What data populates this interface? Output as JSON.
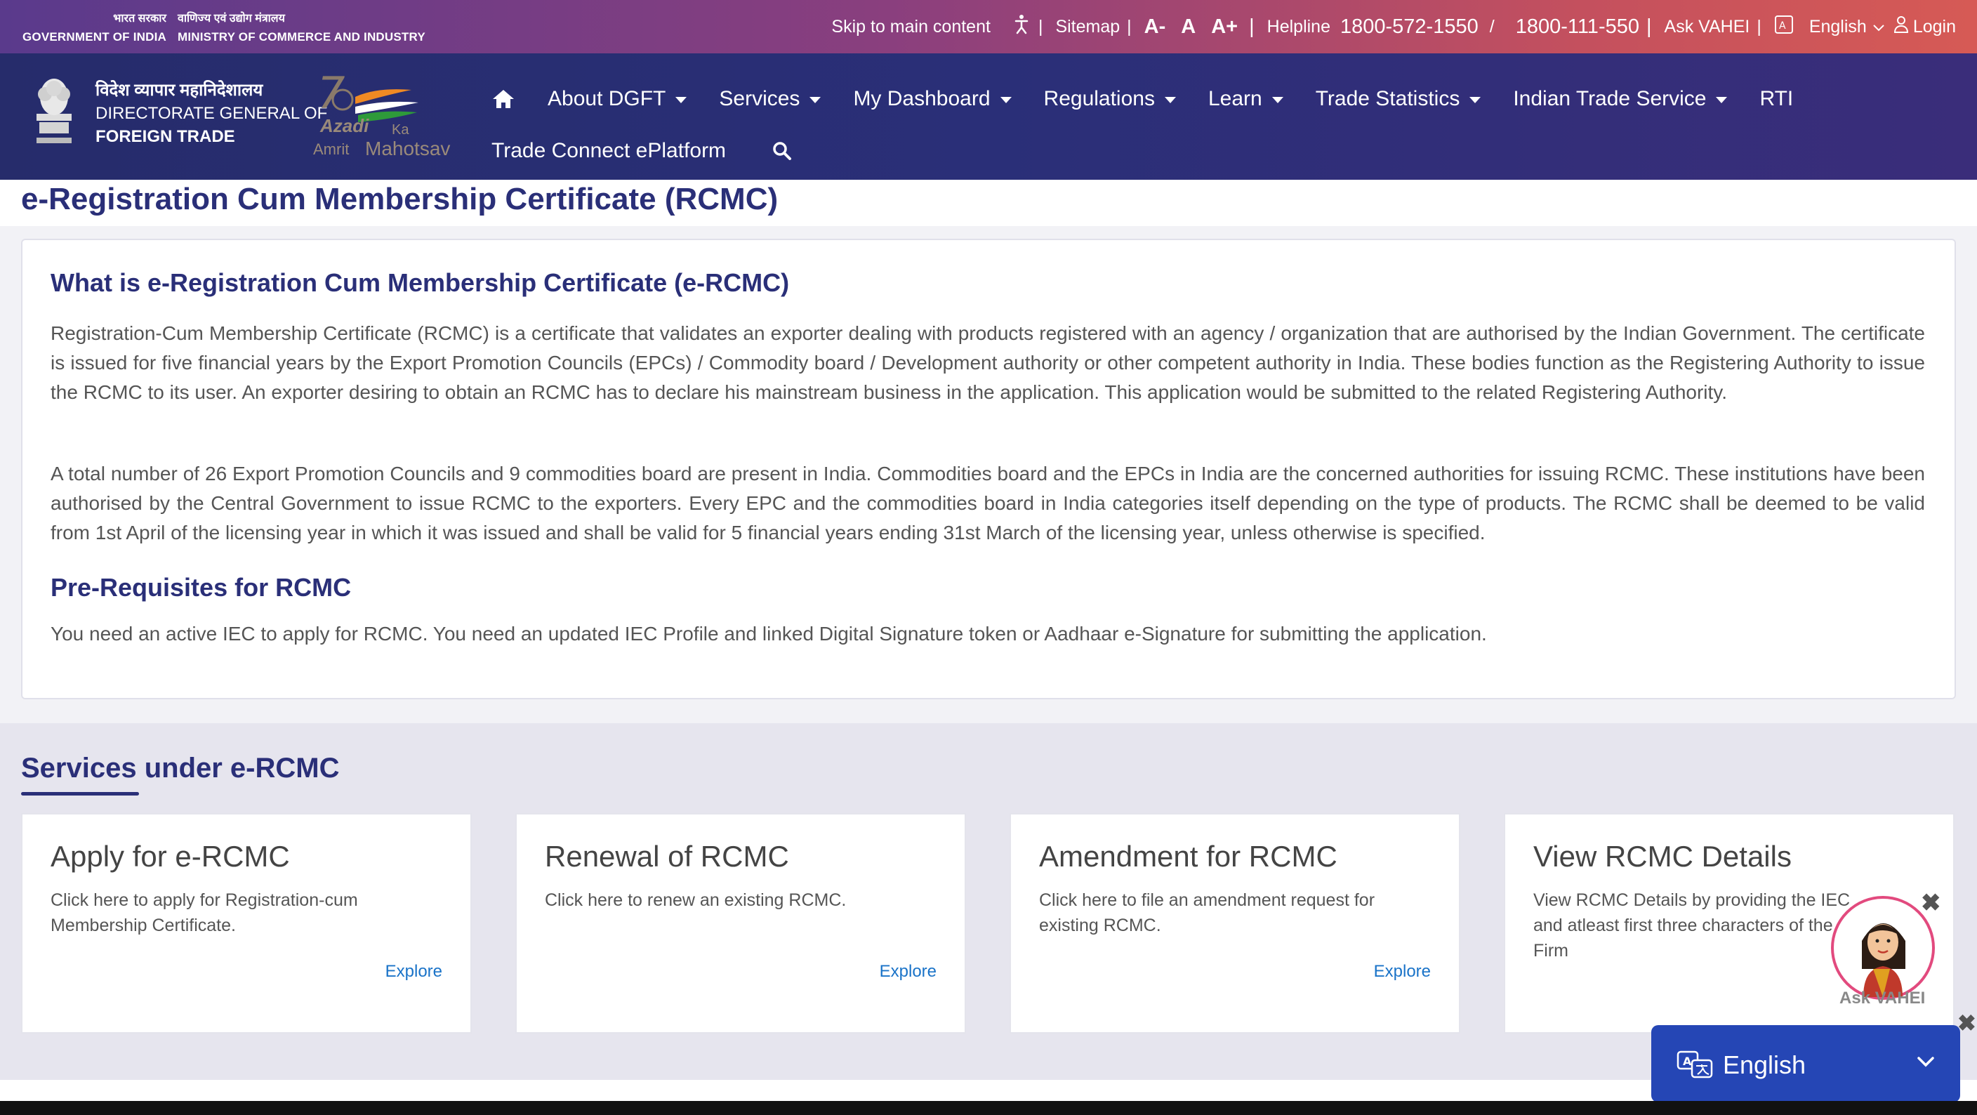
{
  "gov_header": {
    "hindi_gov": "भारत सरकार",
    "hindi_ministry": "वाणिज्य एवं उद्योग मंत्रालय",
    "english_gov": "GOVERNMENT OF INDIA",
    "english_ministry": "MINISTRY OF COMMERCE AND INDUSTRY"
  },
  "utility_bar": {
    "skip": "Skip to main content",
    "sitemap": "Sitemap",
    "font_small": "A-",
    "font_normal": "A",
    "font_large": "A+",
    "helpline_label": "Helpline",
    "helpline_1": "1800-572-1550",
    "helpline_2": "1800-111-550",
    "ask": "Ask VAHEI",
    "language": "English",
    "login": "Login"
  },
  "brand": {
    "hindi": "विदेश व्यापार महानिदेशालय",
    "line1": "DIRECTORATE GENERAL OF",
    "line2": "FOREIGN TRADE",
    "aka_azadi": "Azadi",
    "aka_ka": "Ka",
    "aka_amrit": "Amrit",
    "aka_mahotsav": "Mahotsav"
  },
  "nav": {
    "items": [
      {
        "label": "About DGFT"
      },
      {
        "label": "Services"
      },
      {
        "label": "My Dashboard"
      },
      {
        "label": "Regulations"
      },
      {
        "label": "Learn"
      },
      {
        "label": "Trade Statistics"
      },
      {
        "label": "Indian Trade Service"
      },
      {
        "label": "RTI"
      }
    ],
    "second_row": "Trade Connect ePlatform"
  },
  "page": {
    "title": "e-Registration Cum Membership Certificate (RCMC)",
    "what_heading": "What is e-Registration Cum Membership Certificate (e-RCMC)",
    "para1": "Registration-Cum Membership Certificate (RCMC) is a certificate that validates an exporter dealing with products registered with an agency / organization that are authorised by the Indian Government. The certificate is issued for five financial years by the Export Promotion Councils (EPCs) / Commodity board / Development authority or other competent authority in India. These bodies function as the Registering Authority to issue the RCMC to its user. An exporter desiring to obtain an RCMC has to declare his mainstream business in the application. This application would be submitted to the related Registering Authority.",
    "para2": "A total number of 26 Export Promotion Councils and 9 commodities board are present in India. Commodities board and the EPCs in India are the concerned authorities for issuing RCMC. These institutions have been authorised by the Central Government to issue RCMC to the exporters. Every EPC and the commodities board in India categories itself depending on the type of products. The RCMC shall be deemed to be valid from 1st April of the licensing year in which it was issued and shall be valid for 5 financial years ending 31st March of the licensing year, unless otherwise is specified.",
    "prereq_heading": "Pre-Requisites for RCMC",
    "prereq_text": "You need an active IEC to apply for RCMC. You need an updated IEC Profile and linked Digital Signature token or Aadhaar e-Signature for submitting the application."
  },
  "services": {
    "title": "Services under e-RCMC",
    "cards": [
      {
        "title": "Apply for e-RCMC",
        "desc": "Click here to apply for Registration-cum Membership Certificate.",
        "link": "Explore"
      },
      {
        "title": "Renewal of RCMC",
        "desc": "Click here to renew an existing RCMC.",
        "link": "Explore"
      },
      {
        "title": "Amendment for RCMC",
        "desc": "Click here to file an amendment request for existing RCMC.",
        "link": "Explore"
      },
      {
        "title": "View RCMC Details",
        "desc": "View RCMC Details by providing the IEC and atleast first three characters of the Firm",
        "link": ""
      }
    ]
  },
  "chatbot": {
    "label": "Ask VAHEI",
    "close": "✖"
  },
  "language_widget": {
    "label": "English"
  },
  "colors": {
    "primary": "#2a2f78",
    "link": "#1a73c8",
    "lang_widget": "#2546b5",
    "chatbot_ring": "#e24a7e"
  }
}
